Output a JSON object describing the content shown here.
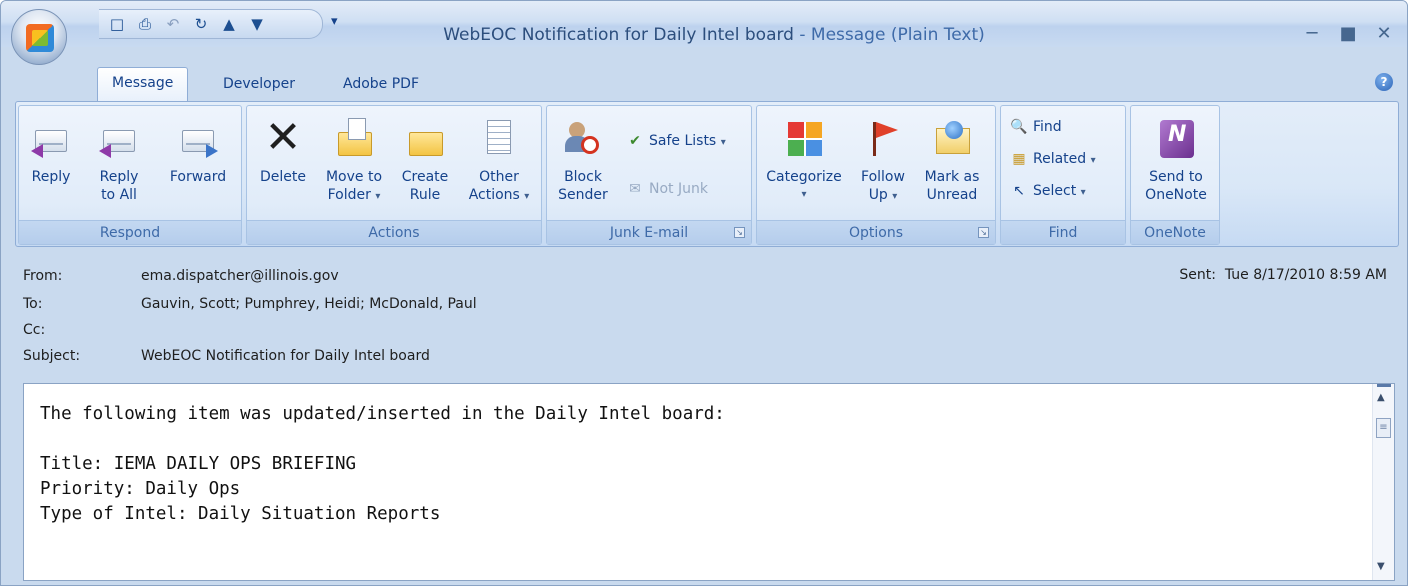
{
  "window": {
    "title": "WebEOC Notification for Daily Intel board",
    "title_suffix": " - Message (Plain Text)"
  },
  "qat": {
    "items": [
      "save-icon",
      "print-icon",
      "undo-icon",
      "redo-icon",
      "previous-item-icon",
      "next-item-icon"
    ],
    "more_symbol": "▾"
  },
  "tabs": [
    "Message",
    "Developer",
    "Adobe PDF"
  ],
  "ribbon": {
    "respond": {
      "label": "Respond",
      "reply": "Reply",
      "reply_all_1": "Reply",
      "reply_all_2": "to All",
      "forward": "Forward"
    },
    "actions": {
      "label": "Actions",
      "delete": "Delete",
      "move_1": "Move to",
      "move_2": "Folder",
      "create_1": "Create",
      "create_2": "Rule",
      "other_1": "Other",
      "other_2": "Actions"
    },
    "junk": {
      "label": "Junk E-mail",
      "block_1": "Block",
      "block_2": "Sender",
      "safe_lists": "Safe Lists",
      "not_junk": "Not Junk"
    },
    "options": {
      "label": "Options",
      "categorize": "Categorize",
      "follow_1": "Follow",
      "follow_2": "Up",
      "mark_1": "Mark as",
      "mark_2": "Unread"
    },
    "find": {
      "label": "Find",
      "find": "Find",
      "related": "Related",
      "select": "Select"
    },
    "onenote": {
      "label": "OneNote",
      "send_1": "Send to",
      "send_2": "OneNote"
    }
  },
  "headers": {
    "from_label": "From:",
    "from": "ema.dispatcher@illinois.gov",
    "to_label": "To:",
    "to": "Gauvin, Scott; Pumphrey, Heidi; McDonald, Paul",
    "cc_label": "Cc:",
    "cc": "",
    "subject_label": "Subject:",
    "subject": "WebEOC Notification for Daily Intel board",
    "sent_label": "Sent:",
    "sent": "Tue 8/17/2010 8:59 AM"
  },
  "body": {
    "lines": [
      "The following item was updated/inserted in the Daily Intel board:",
      "",
      "Title: IEMA DAILY OPS BRIEFING",
      "Priority: Daily Ops",
      "Type of Intel: Daily Situation Reports"
    ]
  }
}
